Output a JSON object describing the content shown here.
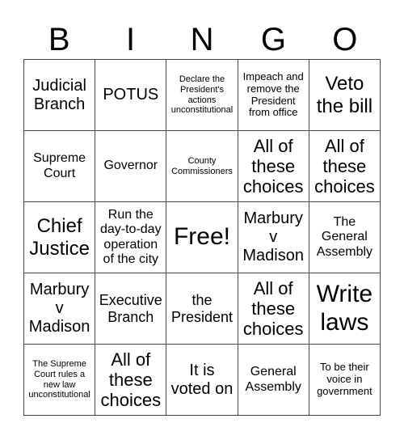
{
  "header": [
    "B",
    "I",
    "N",
    "G",
    "O"
  ],
  "cells": [
    [
      "Judicial Branch",
      "POTUS",
      "Declare the President's actions unconstitutional",
      "Impeach and remove the President from office",
      "Veto the bill"
    ],
    [
      "Supreme Court",
      "Governor",
      "County Commissioners",
      "All of these choices",
      "All of these choices"
    ],
    [
      "Chief Justice",
      "Run the day-to-day operation of the city",
      "Free!",
      "Marbury v Madison",
      "The General Assembly"
    ],
    [
      "Marbury v Madison",
      "Executive Branch",
      "the President",
      "All of these choices",
      "Write laws"
    ],
    [
      "The Supreme Court rules a new law unconstitutional",
      "All of these choices",
      "It is voted on",
      "General Assembly",
      "To be their voice in government"
    ]
  ]
}
